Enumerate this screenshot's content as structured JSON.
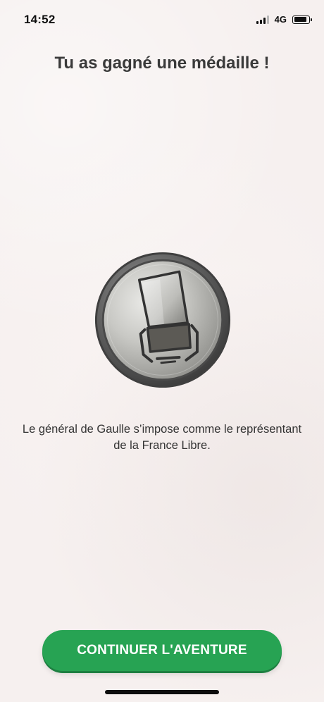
{
  "status_bar": {
    "time": "14:52",
    "network": "4G",
    "icons": [
      "signal-icon",
      "battery-icon"
    ]
  },
  "header": {
    "title": "Tu as gagné une médaille !"
  },
  "medal": {
    "icon": "microphone-medal-icon",
    "colors": {
      "rim": "#5a5a5a",
      "face": "#c9c9c9"
    }
  },
  "description": {
    "text": "Le général de Gaulle s’impose comme le représentant de la France Libre."
  },
  "actions": {
    "continue_label": "CONTINUER L'AVENTURE"
  },
  "colors": {
    "accent": "#27a353",
    "background": "#f6f0ef"
  }
}
